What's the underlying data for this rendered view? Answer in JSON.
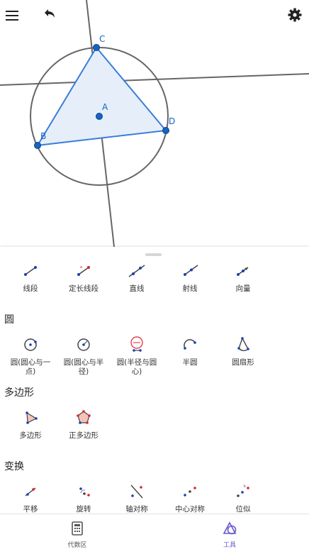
{
  "canvas": {
    "points": [
      {
        "name": "C"
      },
      {
        "name": "A"
      },
      {
        "name": "B"
      },
      {
        "name": "D"
      }
    ],
    "colors": {
      "point": "#1565c0",
      "polygon_stroke": "#3b7dd8",
      "polygon_fill": "#e6eef9",
      "line": "#666666"
    }
  },
  "top_bar": {
    "menu_icon": "menu-icon",
    "undo_icon": "undo-icon",
    "settings_icon": "gear-icon"
  },
  "tools": {
    "lines": [
      {
        "label": "线段",
        "icon": "segment-icon"
      },
      {
        "label": "定长线段",
        "icon": "fixed-segment-icon"
      },
      {
        "label": "直线",
        "icon": "line-icon"
      },
      {
        "label": "射线",
        "icon": "ray-icon"
      },
      {
        "label": "向量",
        "icon": "vector-icon"
      }
    ],
    "circles_title": "圆",
    "circles": [
      {
        "label1": "圆(圆心与一",
        "label2": "点)",
        "icon": "circle-center-point-icon"
      },
      {
        "label1": "圆(圆心与半",
        "label2": "径)",
        "icon": "circle-center-radius-icon"
      },
      {
        "label1": "圆(半径与圆",
        "label2": "心)",
        "icon": "compass-icon"
      },
      {
        "label1": "半圆",
        "label2": "",
        "icon": "semicircle-icon"
      },
      {
        "label1": "圆扇形",
        "label2": "",
        "icon": "sector-icon"
      }
    ],
    "polygons_title": "多边形",
    "polygons": [
      {
        "label": "多边形",
        "icon": "polygon-icon"
      },
      {
        "label": "正多边形",
        "icon": "regular-polygon-icon"
      }
    ],
    "transform_title": "变换",
    "transforms": [
      {
        "label": "平移",
        "icon": "translate-icon"
      },
      {
        "label": "旋转",
        "icon": "rotate-icon"
      },
      {
        "label": "轴对称",
        "icon": "reflect-line-icon"
      },
      {
        "label": "中心对称",
        "icon": "reflect-point-icon"
      },
      {
        "label": "位似",
        "icon": "dilate-icon"
      }
    ]
  },
  "bottom_nav": {
    "algebra": {
      "label": "代数区",
      "icon": "calculator-icon"
    },
    "tools": {
      "label": "工具",
      "icon": "tools-icon"
    },
    "active_color": "#6557d2"
  }
}
